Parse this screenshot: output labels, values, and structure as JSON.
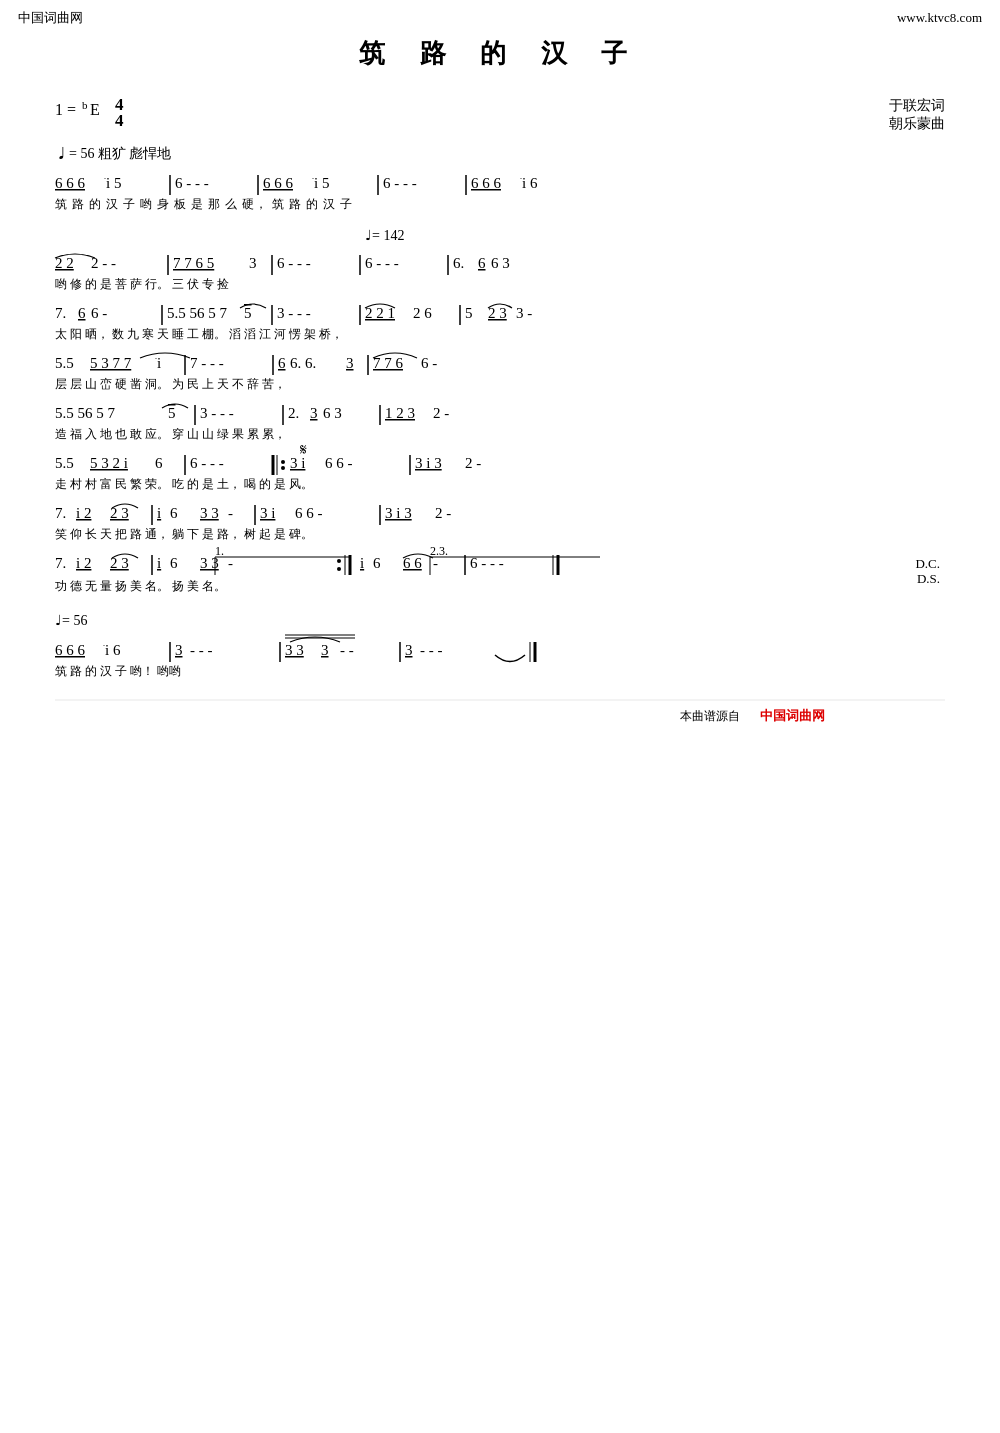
{
  "page": {
    "title": "筑 路 的 汉 子",
    "top_left": "中国词曲网",
    "top_right": "www.ktvc8.com",
    "key": "1 = ᵇE",
    "time": "4/4",
    "composer1": "于联宏词",
    "composer2": "朝乐蒙曲",
    "tempo1": "♩= 56  粗犷 彪悍地",
    "tempo2": "♩= 142",
    "tempo3": "♩= 56",
    "footer1": "本曲谱源自",
    "footer2": "中国词曲网",
    "dc_ds": "D.C.\nD.S."
  },
  "rows": [
    {
      "id": "row1",
      "notes": "6̲ 6̲ 6̲ i 5  |  6 - - -  |  6̲ 6̲ 6̲ i 5  |  6 - - -  |  6̲ 6̲ 6̲ i 6",
      "lyrics": "筑  路  的  汉  子  哟         身  板  是  那  么  硬，         筑  路  的  汉  子"
    },
    {
      "id": "row2",
      "notes": "2̲ 2̲ 2 - -  |  7̲ 7̲ 6̲ 5 3  |  6 - - -  |  6 - - -  |  6· 6̲ 6 3",
      "lyrics": "哟               修  的  是  菩  萨  行。                              三  伏  专  捡"
    },
    {
      "id": "row3",
      "notes": "7· 6̲ 6 -  |  5·5̲ 5 6 5  7 5̲  |  3 - - -  |  2̲ 2̲ 1̲ 2 6  |  5 2̲3̲ 3 -",
      "lyrics": "太  阳  晒，      数  九  寒  天  睡  工  棚。         滔  滔     江  河  愣  架  桥，"
    },
    {
      "id": "row4",
      "notes": "5·5̲ 5 3  7̲ 7̲  i  |  7 - - -  |  6̲ 6·6· 3̲  |  7̲ 7̲ 6̲ 6 -",
      "lyrics": "层  层  山  峦  硬  凿     洞。           为  民  上  天  不  辞     苦，"
    },
    {
      "id": "row5",
      "notes": "5·5̲ 5 6 5  7 5̲  |  3 - - -  |  2·3̲ 6 3  |  1̲ 2̲ 3̲ 2 -",
      "lyrics": "造  福  入  地  也  敢     应。           穿  山  山  绿  果  累     累，"
    },
    {
      "id": "row6",
      "notes": "5·5̲ 5 3  2̲ i̲ 6  |  6 - - -  ||: 3̲ i̲ 6 6 -  |  3̲ i̲ 3̲ 2 -",
      "lyrics": "走  村  村  富  民  繁     荣。           吃  的  是  土，      喝  的  是  风。"
    },
    {
      "id": "row7",
      "notes": "7· i̲ 2̲  2̲3̲  |  i̲ 6  3̲ 3 -  |  3̲ i̲ 6 6 -  |  3̲ i̲ 3̲ 2 -",
      "lyrics": "笑  仰  长  天     把  路  通，         躺  下  是  路，      树  起  是  碑。"
    },
    {
      "id": "row8",
      "notes": "7· i̲ 2̲  2̲3̲  |  i̲ 6  3̲3̲ -  :|  i̲ 6  6̲6̲ -  |  6 - - -  ‖",
      "lyrics": "功  德  无  量     扬  美  名。         扬  美  名。"
    },
    {
      "id": "row9",
      "notes": "6̲ 6̲ 6̲ i 6  |  3̲ - - -  |  3̲3̲ 3̲ - -  |  3̲ - - -  ‖",
      "lyrics": "筑  路  的  汉  子  哟！         哟哟"
    }
  ]
}
